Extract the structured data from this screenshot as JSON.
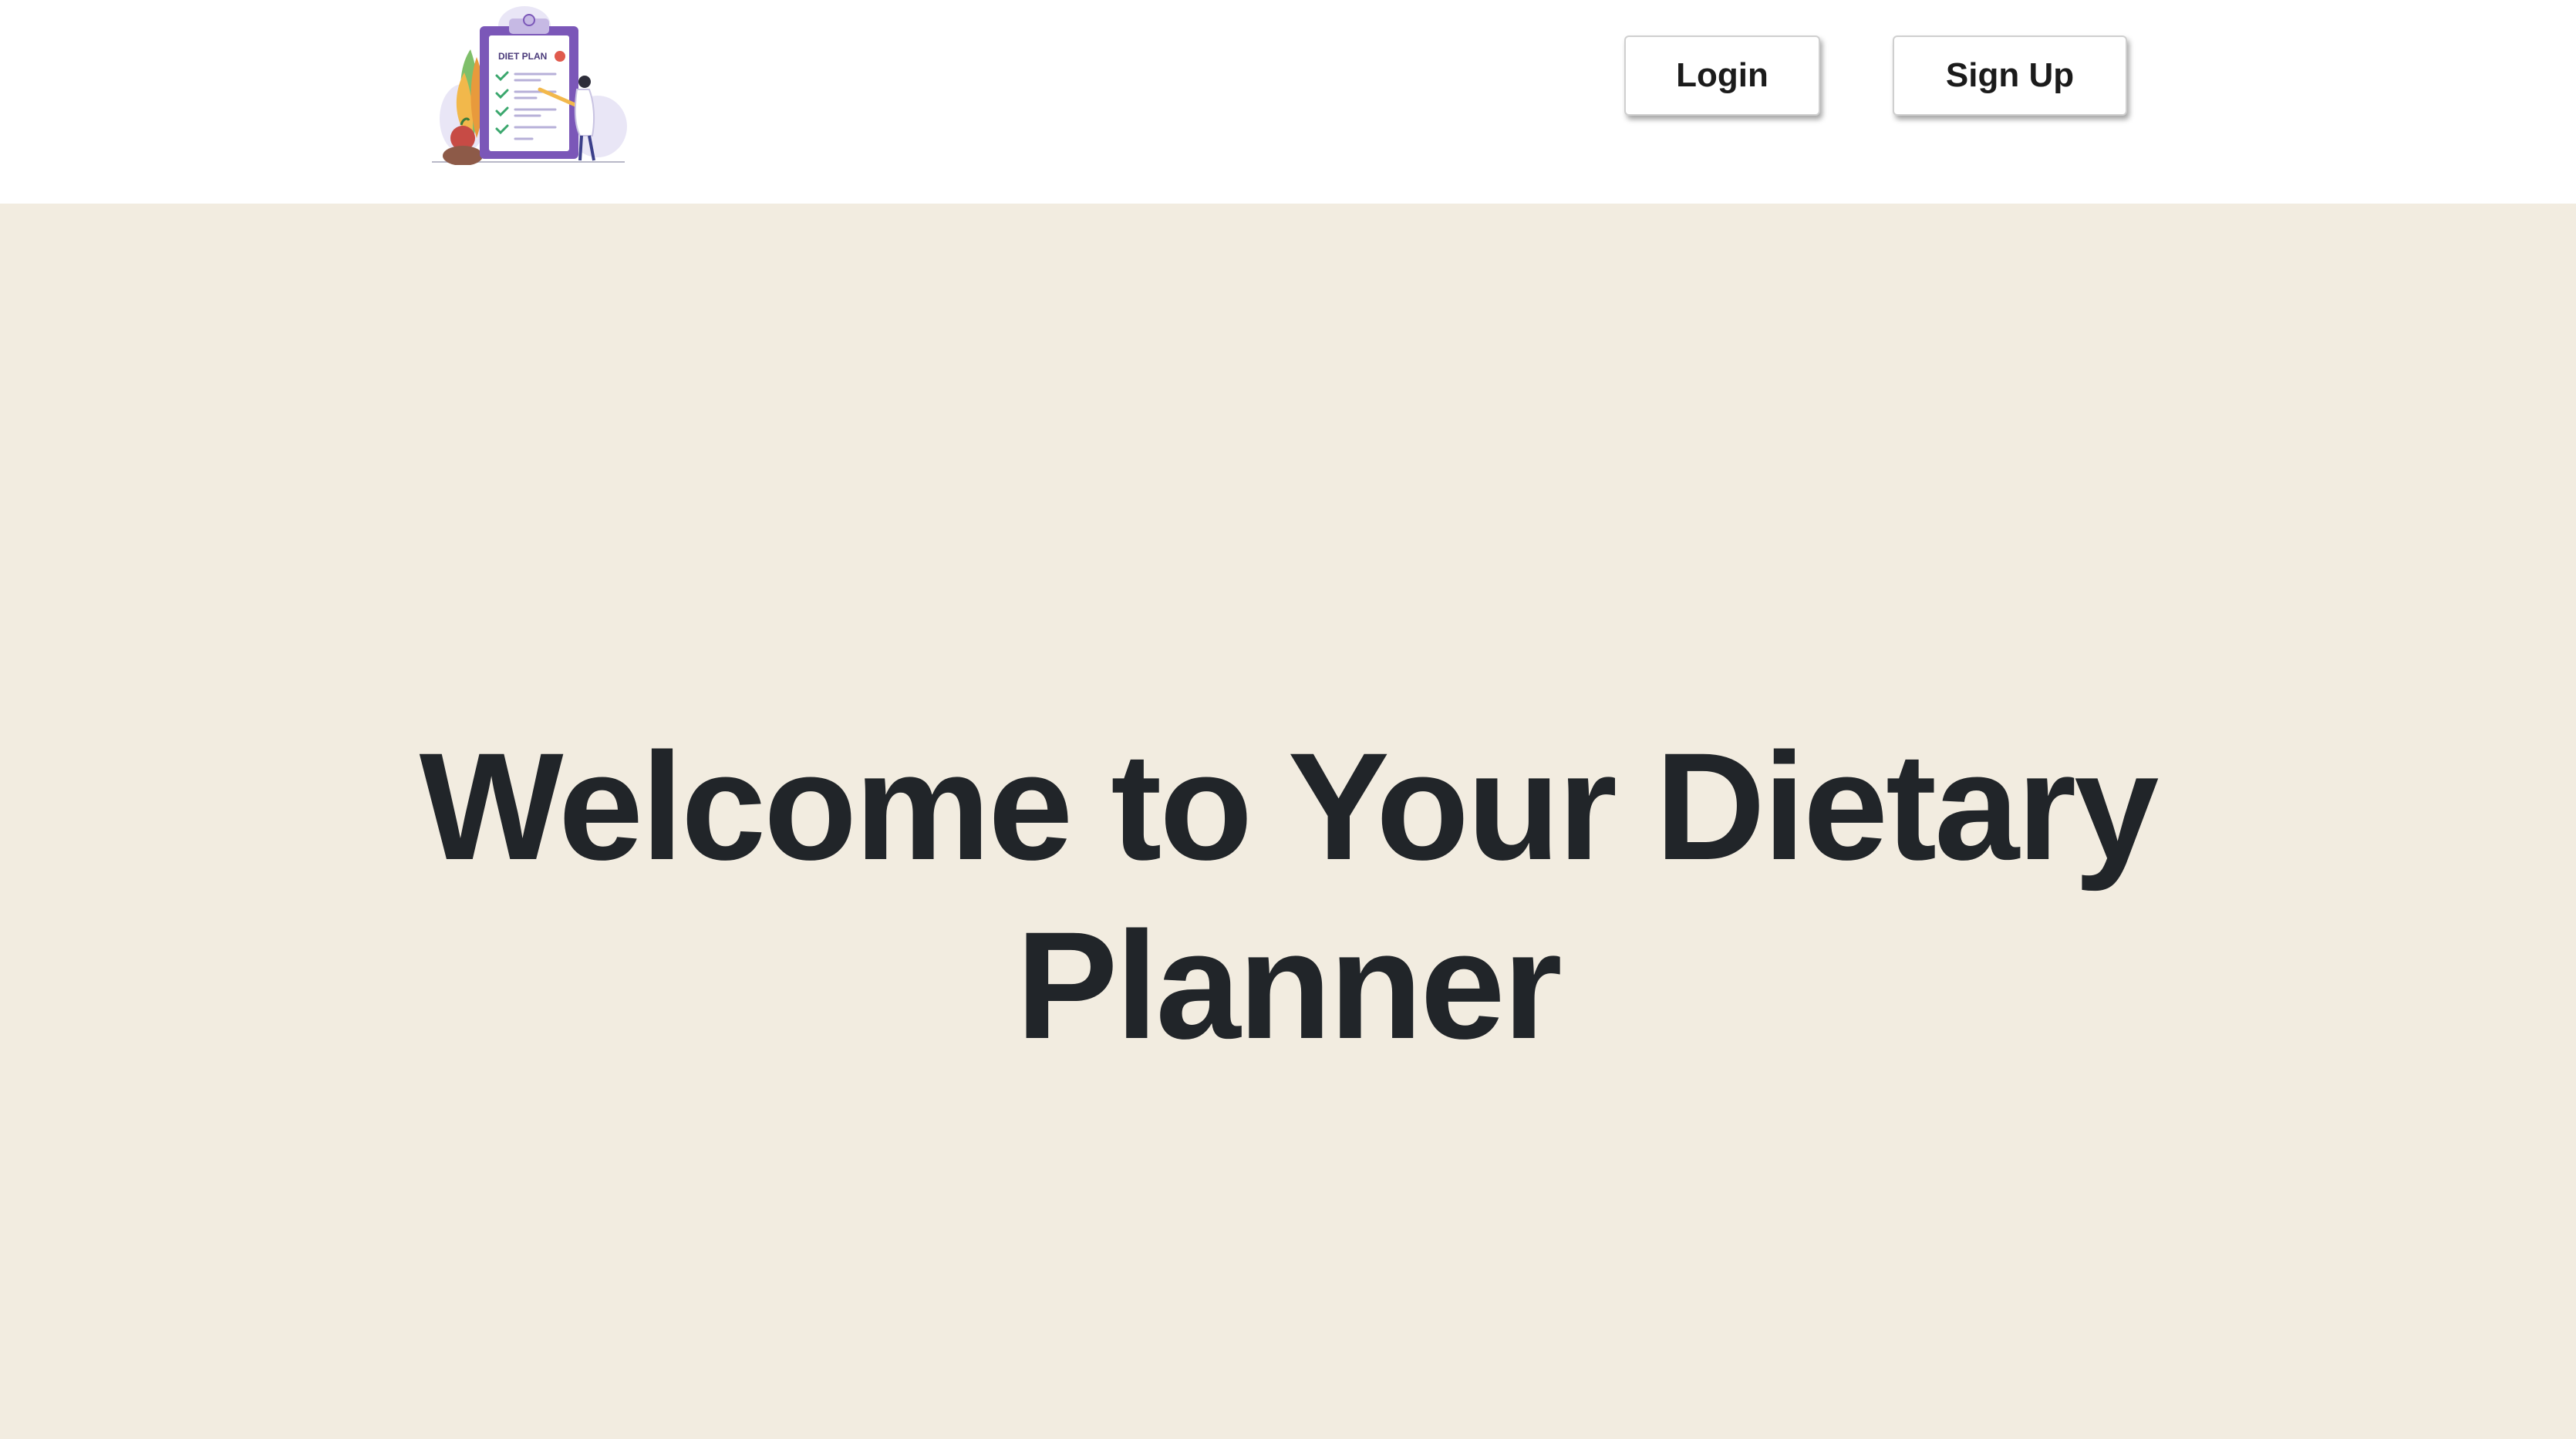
{
  "header": {
    "logo": {
      "icon": "diet-plan-clipboard-icon",
      "text": "DIET PLAN"
    },
    "login_label": "Login",
    "signup_label": "Sign Up"
  },
  "hero": {
    "title": "Welcome to Your Dietary Planner"
  },
  "colors": {
    "page_background": "#f2ece0",
    "header_background": "#ffffff",
    "text": "#212529",
    "clipboard": "#7b57b8"
  }
}
